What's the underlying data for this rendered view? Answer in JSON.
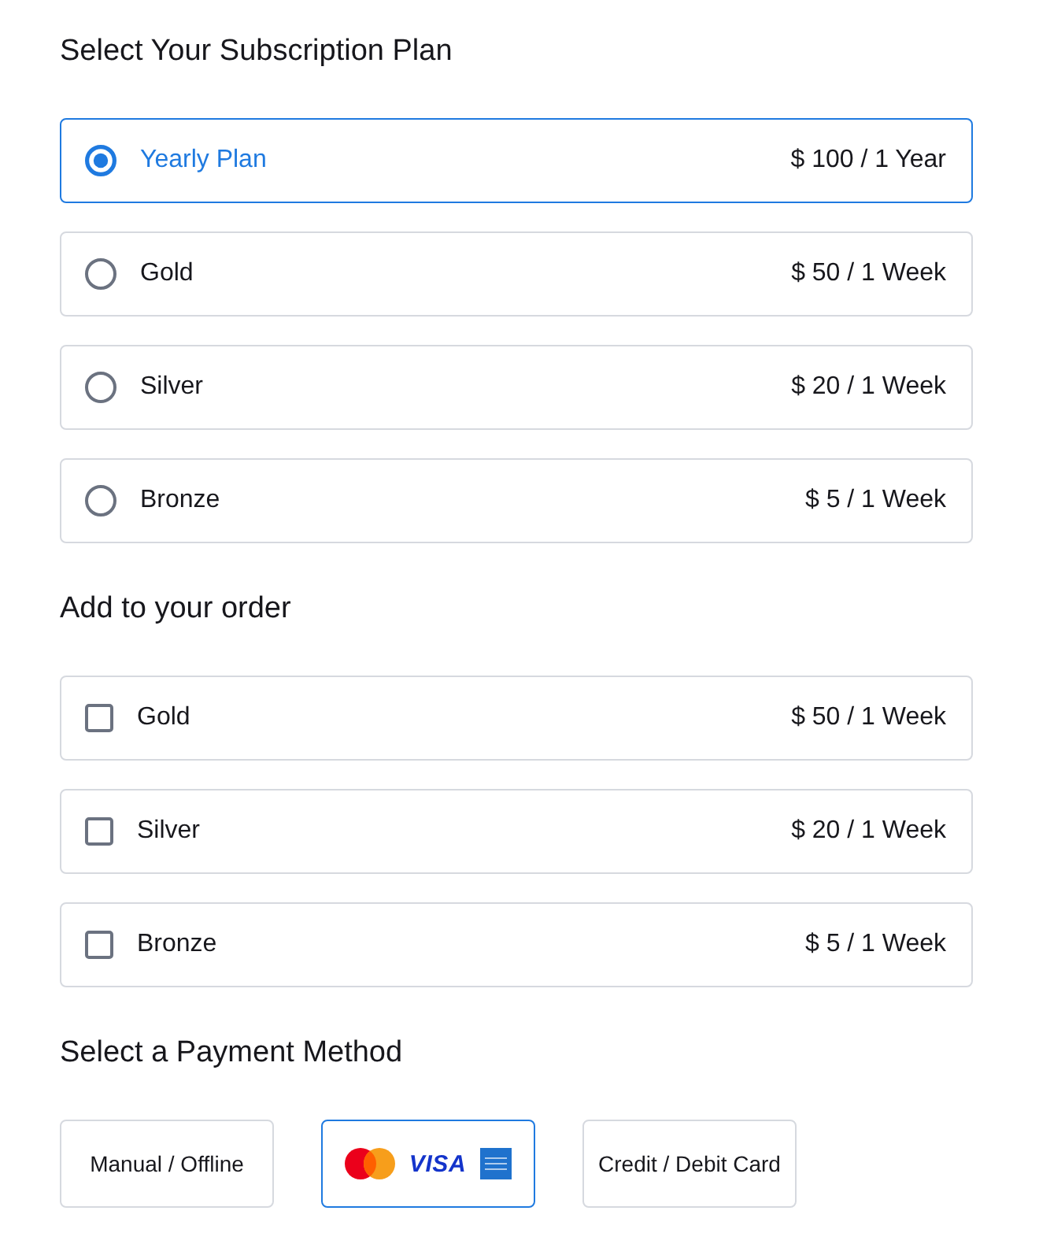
{
  "sections": [
    {
      "kind": "radio",
      "title": "Select Your Subscription Plan",
      "options": [
        {
          "label": "Yearly Plan",
          "price": "$ 100 / 1 Year",
          "selected": true
        },
        {
          "label": "Gold",
          "price": "$ 50 / 1 Week",
          "selected": false
        },
        {
          "label": "Silver",
          "price": "$ 20 / 1 Week",
          "selected": false
        },
        {
          "label": "Bronze",
          "price": "$ 5 / 1 Week",
          "selected": false
        }
      ]
    },
    {
      "kind": "checkbox",
      "title": "Add to your order",
      "options": [
        {
          "label": "Gold",
          "price": "$ 50 / 1 Week",
          "checked": false
        },
        {
          "label": "Silver",
          "price": "$ 20 / 1 Week",
          "checked": false
        },
        {
          "label": "Bronze",
          "price": "$ 5 / 1 Week",
          "checked": false
        }
      ]
    },
    {
      "kind": "payment",
      "title": "Select a Payment Method",
      "methods": [
        {
          "kind": "text",
          "label": "Manual / Offline",
          "selected": false
        },
        {
          "kind": "card_logos",
          "logo_text": "VISA",
          "selected": true
        },
        {
          "kind": "text",
          "label": "Credit / Debit Card",
          "selected": false
        }
      ]
    }
  ]
}
